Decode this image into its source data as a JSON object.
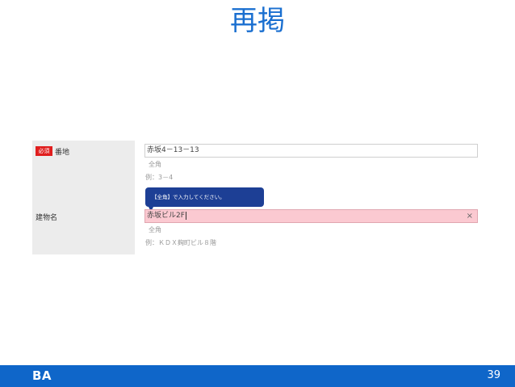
{
  "slide": {
    "title": "再掲"
  },
  "form": {
    "address": {
      "required_badge": "必須",
      "label": "番地",
      "value": "赤坂4－13－13",
      "hint_type": "全角",
      "hint_example": "例：3－4"
    },
    "building": {
      "label": "建物名",
      "value": "赤坂ビル2F",
      "tooltip": "【全角】で入力してください。",
      "clear_icon": "×",
      "hint_type": "全角",
      "hint_example": "例：ＫＤＸ麹町ビル８階"
    }
  },
  "footer": {
    "logo": "BA",
    "page_number": "39",
    "bar_color": "#0f66c9"
  },
  "colors": {
    "title": "#1a6fd0",
    "required_badge": "#e01e1e",
    "error_field": "#fbc9d1",
    "tooltip": "#1d3f95"
  }
}
